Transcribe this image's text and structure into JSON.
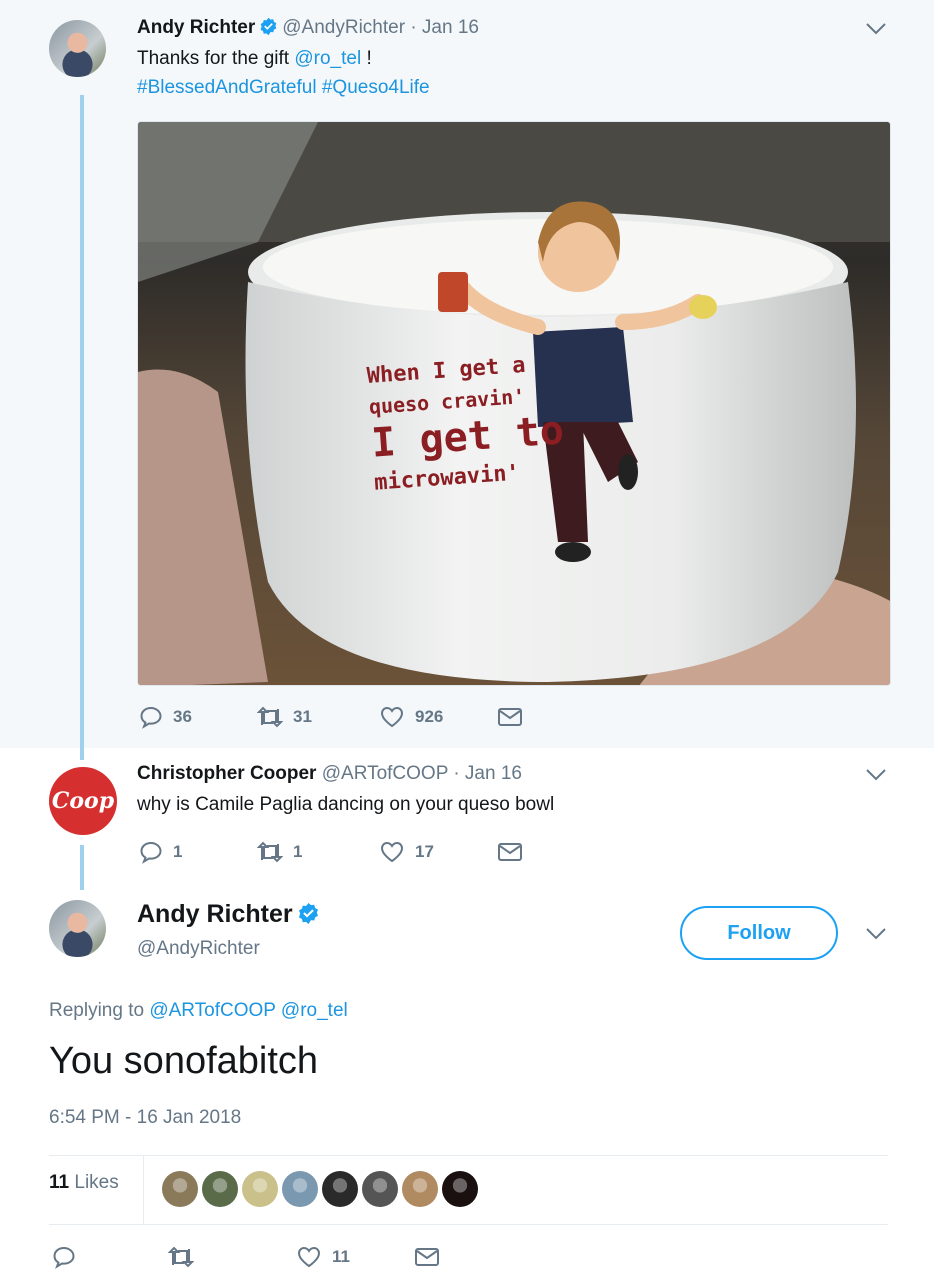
{
  "tweet1": {
    "name": "Andy Richter",
    "handle": "@AndyRichter",
    "date": "· Jan 16",
    "text_prefix": "Thanks for the gift ",
    "mention": "@ro_tel",
    "text_suffix": " !",
    "hashtag1": "#BlessedAndGrateful",
    "hashtag2": "#Queso4Life",
    "media": {
      "line1": "When I get a",
      "line2": "queso cravin'",
      "line3": "I get to",
      "line4": "microwavin'"
    },
    "replies": "36",
    "retweets": "31",
    "likes": "926"
  },
  "tweet2": {
    "avatar_text": "Coop",
    "name": "Christopher Cooper",
    "handle": "@ARTofCOOP",
    "date": "· Jan 16",
    "text": "why is Camile Paglia dancing on your queso bowl",
    "replies": "1",
    "retweets": "1",
    "likes": "17"
  },
  "main": {
    "name": "Andy Richter",
    "handle": "@AndyRichter",
    "follow_label": "Follow",
    "replying_prefix": "Replying to ",
    "replying_to1": "@ARTofCOOP",
    "replying_to2": "@ro_tel",
    "text": "You sonofabitch",
    "timestamp": "6:54 PM - 16 Jan 2018",
    "likes_count": "11",
    "likes_label": "Likes",
    "like_action_count": "11"
  },
  "colors": {
    "accent": "#1da1f2",
    "link": "#1b95e0",
    "muted": "#657786",
    "thread_line": "#9fd0ee"
  },
  "likers": [
    {
      "icon": "liker-avatar",
      "color": "#8a7a5a"
    },
    {
      "icon": "liker-avatar",
      "color": "#5a6b4a"
    },
    {
      "icon": "liker-avatar",
      "color": "#c9c08a"
    },
    {
      "icon": "liker-avatar",
      "color": "#7a98b0"
    },
    {
      "icon": "liker-avatar",
      "color": "#2a2a2a"
    },
    {
      "icon": "liker-avatar",
      "color": "#555555"
    },
    {
      "icon": "liker-avatar",
      "color": "#b08a60"
    },
    {
      "icon": "liker-avatar",
      "color": "#1a1010"
    }
  ]
}
